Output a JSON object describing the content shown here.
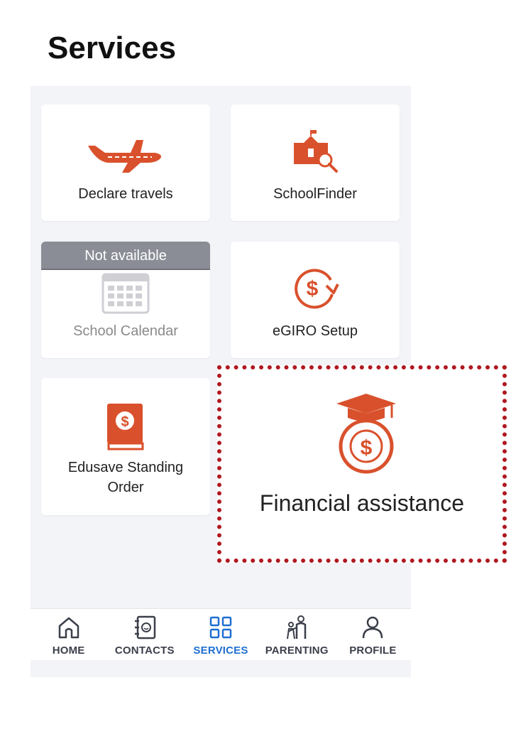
{
  "page_title": "Services",
  "colors": {
    "accent": "#D9512C",
    "active_nav": "#1F6FD1",
    "highlight_border": "#B01820",
    "disabled_banner": "#8B8D96"
  },
  "tiles": [
    {
      "label": "Declare travels",
      "icon": "airplane-icon",
      "available": true
    },
    {
      "label": "SchoolFinder",
      "icon": "school-search-icon",
      "available": true
    },
    {
      "label": "School Calendar",
      "icon": "calendar-icon",
      "available": false,
      "banner": "Not available"
    },
    {
      "label": "eGIRO Setup",
      "icon": "dollar-refresh-icon",
      "available": true
    },
    {
      "label_line1": "Edusave Standing",
      "label_line2": "Order",
      "icon": "dollar-book-icon",
      "available": true
    }
  ],
  "highlighted_tile": {
    "label": "Financial assistance",
    "icon": "graduation-dollar-icon"
  },
  "nav": [
    {
      "label": "HOME",
      "icon": "home-icon",
      "active": false
    },
    {
      "label": "CONTACTS",
      "icon": "contacts-icon",
      "active": false
    },
    {
      "label": "SERVICES",
      "icon": "grid-icon",
      "active": true
    },
    {
      "label": "PARENTING",
      "icon": "parenting-icon",
      "active": false
    },
    {
      "label": "PROFILE",
      "icon": "profile-icon",
      "active": false
    }
  ]
}
